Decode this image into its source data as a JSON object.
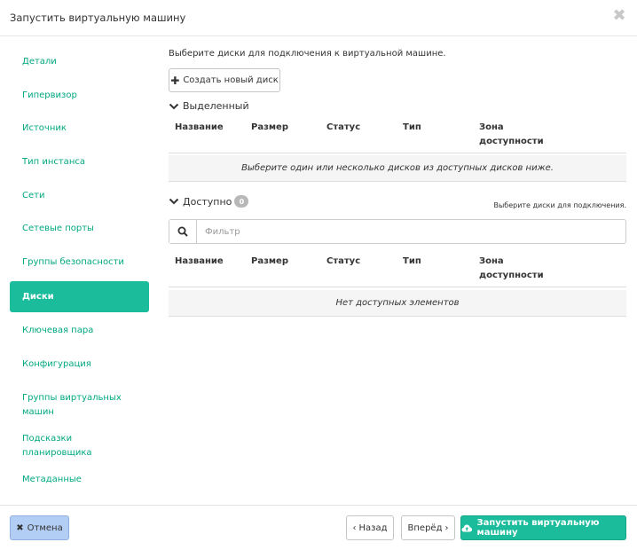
{
  "dialog": {
    "title": "Запустить виртуальную машину",
    "close_glyph": "✖"
  },
  "sidebar": {
    "items": [
      {
        "label": "Детали",
        "active": false
      },
      {
        "label": "Гипервизор",
        "active": false
      },
      {
        "label": "Источник",
        "active": false
      },
      {
        "label": "Тип инстанса",
        "active": false
      },
      {
        "label": "Сети",
        "active": false
      },
      {
        "label": "Сетевые порты",
        "active": false
      },
      {
        "label": "Группы безопасности",
        "active": false
      },
      {
        "label": "Диски",
        "active": true
      },
      {
        "label": "Ключевая пара",
        "active": false
      },
      {
        "label": "Конфигурация",
        "active": false
      },
      {
        "label": "Группы виртуальных машин",
        "active": false
      },
      {
        "label": "Подсказки планировщика",
        "active": false
      },
      {
        "label": "Метаданные",
        "active": false
      }
    ]
  },
  "main": {
    "intro": "Выберите диски для подключения к виртуальной машине.",
    "create_button": "Создать новый диск",
    "allocated": {
      "title": "Выделенный",
      "columns": [
        "Название",
        "Размер",
        "Статус",
        "Тип",
        "Зона доступности"
      ],
      "empty_text": "Выберите один или несколько дисков из доступных дисков ниже."
    },
    "available": {
      "title": "Доступно",
      "count": "0",
      "hint": "Выберите диски для подключения.",
      "filter_placeholder": "Фильтр",
      "columns": [
        "Название",
        "Размер",
        "Статус",
        "Тип",
        "Зона доступности"
      ],
      "empty_text": "Нет доступных элементов"
    }
  },
  "footer": {
    "cancel": "Отмена",
    "back": "Назад",
    "next": "Вперёд",
    "launch": "Запустить виртуальную машину"
  },
  "colors": {
    "accent": "#1abc9c",
    "link": "#00a880",
    "cancel_bg": "#b3cef5"
  },
  "icons": {
    "close": "close-icon",
    "plus": "plus-icon",
    "chevron": "chevron-down-icon",
    "search": "search-icon",
    "cancel": "times-icon",
    "back": "chevron-left-icon",
    "next": "chevron-right-icon",
    "launch": "cloud-upload-icon"
  }
}
